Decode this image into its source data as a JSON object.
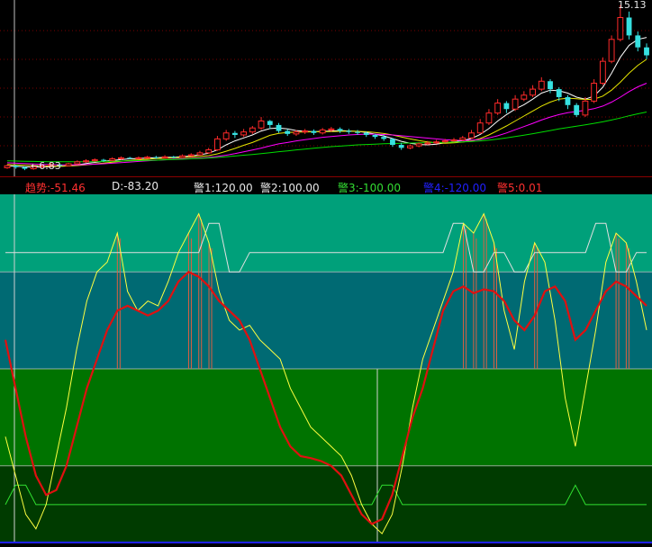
{
  "chart_data": [
    {
      "type": "candlestick",
      "annotations": [
        {
          "text": "←6.83",
          "kind": "low-price-label"
        },
        {
          "text": "15.13",
          "kind": "high-price-label"
        }
      ],
      "candles": [
        [
          6.95,
          7.05,
          7.12,
          6.9
        ],
        [
          7.05,
          6.98,
          7.1,
          6.9
        ],
        [
          6.98,
          6.9,
          7.02,
          6.83
        ],
        [
          6.9,
          7.0,
          7.05,
          6.85
        ],
        [
          7.0,
          7.05,
          7.1,
          6.95
        ],
        [
          7.05,
          7.1,
          7.18,
          7.0
        ],
        [
          7.1,
          7.05,
          7.15,
          7.0
        ],
        [
          7.05,
          7.15,
          7.2,
          7.02
        ],
        [
          7.15,
          7.25,
          7.32,
          7.1
        ],
        [
          7.25,
          7.3,
          7.38,
          7.2
        ],
        [
          7.3,
          7.35,
          7.42,
          7.25
        ],
        [
          7.35,
          7.32,
          7.4,
          7.25
        ],
        [
          7.32,
          7.4,
          7.48,
          7.28
        ],
        [
          7.4,
          7.45,
          7.52,
          7.35
        ],
        [
          7.45,
          7.42,
          7.5,
          7.38
        ],
        [
          7.42,
          7.45,
          7.52,
          7.36
        ],
        [
          7.45,
          7.48,
          7.55,
          7.4
        ],
        [
          7.48,
          7.45,
          7.55,
          7.4
        ],
        [
          7.45,
          7.5,
          7.58,
          7.42
        ],
        [
          7.5,
          7.48,
          7.55,
          7.42
        ],
        [
          7.48,
          7.55,
          7.62,
          7.45
        ],
        [
          7.55,
          7.6,
          7.68,
          7.5
        ],
        [
          7.6,
          7.7,
          7.8,
          7.55
        ],
        [
          7.7,
          7.85,
          7.95,
          7.65
        ],
        [
          7.85,
          8.4,
          8.55,
          7.8
        ],
        [
          8.4,
          8.7,
          8.85,
          8.3
        ],
        [
          8.7,
          8.6,
          8.8,
          8.45
        ],
        [
          8.6,
          8.75,
          8.9,
          8.5
        ],
        [
          8.75,
          8.95,
          9.05,
          8.65
        ],
        [
          8.95,
          9.3,
          9.5,
          8.85
        ],
        [
          9.3,
          9.1,
          9.35,
          8.9
        ],
        [
          9.1,
          8.8,
          9.2,
          8.7
        ],
        [
          8.8,
          8.65,
          8.9,
          8.55
        ],
        [
          8.65,
          8.75,
          8.85,
          8.55
        ],
        [
          8.75,
          8.8,
          8.9,
          8.65
        ],
        [
          8.8,
          8.7,
          8.88,
          8.6
        ],
        [
          8.7,
          8.85,
          8.95,
          8.62
        ],
        [
          8.85,
          8.9,
          9.0,
          8.75
        ],
        [
          8.9,
          8.8,
          8.98,
          8.7
        ],
        [
          8.8,
          8.75,
          8.9,
          8.65
        ],
        [
          8.75,
          8.7,
          8.85,
          8.6
        ],
        [
          8.7,
          8.6,
          8.78,
          8.5
        ],
        [
          8.6,
          8.5,
          8.65,
          8.4
        ],
        [
          8.5,
          8.4,
          8.6,
          8.3
        ],
        [
          8.4,
          8.1,
          8.45,
          8.0
        ],
        [
          8.1,
          7.95,
          8.2,
          7.85
        ],
        [
          7.95,
          8.05,
          8.12,
          7.88
        ],
        [
          8.05,
          8.15,
          8.22,
          7.98
        ],
        [
          8.15,
          8.2,
          8.3,
          8.1
        ],
        [
          8.2,
          8.25,
          8.35,
          8.15
        ],
        [
          8.25,
          8.3,
          8.4,
          8.2
        ],
        [
          8.3,
          8.35,
          8.45,
          8.25
        ],
        [
          8.35,
          8.45,
          8.55,
          8.3
        ],
        [
          8.45,
          8.7,
          8.85,
          8.4
        ],
        [
          8.7,
          9.2,
          9.4,
          8.65
        ],
        [
          9.2,
          9.7,
          9.9,
          9.1
        ],
        [
          9.7,
          10.2,
          10.4,
          9.6
        ],
        [
          10.2,
          9.9,
          10.3,
          9.7
        ],
        [
          9.9,
          10.4,
          10.6,
          9.8
        ],
        [
          10.4,
          10.6,
          10.8,
          10.3
        ],
        [
          10.6,
          10.9,
          11.1,
          10.5
        ],
        [
          10.9,
          11.3,
          11.5,
          10.8
        ],
        [
          11.3,
          10.9,
          11.4,
          10.7
        ],
        [
          10.9,
          10.5,
          11.0,
          10.3
        ],
        [
          10.5,
          10.1,
          10.6,
          9.9
        ],
        [
          10.1,
          9.6,
          10.2,
          9.5
        ],
        [
          9.6,
          10.3,
          10.5,
          9.5
        ],
        [
          10.3,
          11.2,
          11.4,
          10.2
        ],
        [
          11.2,
          12.3,
          12.5,
          11.1
        ],
        [
          12.3,
          13.4,
          13.6,
          12.2
        ],
        [
          13.4,
          14.5,
          15.13,
          13.3
        ],
        [
          14.5,
          13.6,
          14.8,
          13.4
        ],
        [
          13.6,
          13.0,
          13.8,
          12.8
        ],
        [
          13.0,
          12.6,
          13.2,
          12.4
        ]
      ],
      "moving_averages": [
        {
          "color": "#ffffff",
          "values": [
            7.05,
            7.03,
            7.0,
            6.98,
            6.98,
            7.0,
            7.02,
            7.05,
            7.1,
            7.16,
            7.22,
            7.28,
            7.32,
            7.36,
            7.4,
            7.42,
            7.44,
            7.46,
            7.47,
            7.48,
            7.5,
            7.54,
            7.6,
            7.68,
            7.85,
            8.1,
            8.3,
            8.45,
            8.6,
            8.8,
            8.92,
            8.95,
            8.9,
            8.82,
            8.78,
            8.76,
            8.78,
            8.8,
            8.82,
            8.8,
            8.78,
            8.72,
            8.64,
            8.55,
            8.42,
            8.28,
            8.18,
            8.12,
            8.1,
            8.14,
            8.2,
            8.26,
            8.32,
            8.42,
            8.62,
            8.92,
            9.3,
            9.62,
            9.9,
            10.12,
            10.4,
            10.7,
            10.85,
            10.82,
            10.7,
            10.5,
            10.4,
            10.55,
            11.0,
            11.7,
            12.5,
            13.1,
            13.4,
            13.5
          ]
        },
        {
          "color": "#e6e600",
          "values": [
            7.12,
            7.1,
            7.08,
            7.06,
            7.04,
            7.03,
            7.03,
            7.04,
            7.06,
            7.1,
            7.14,
            7.19,
            7.23,
            7.28,
            7.32,
            7.35,
            7.38,
            7.41,
            7.43,
            7.45,
            7.47,
            7.49,
            7.52,
            7.56,
            7.65,
            7.78,
            7.92,
            8.08,
            8.22,
            8.4,
            8.58,
            8.68,
            8.72,
            8.74,
            8.75,
            8.76,
            8.76,
            8.77,
            8.78,
            8.79,
            8.78,
            8.76,
            8.72,
            8.67,
            8.6,
            8.5,
            8.4,
            8.32,
            8.25,
            8.2,
            8.18,
            8.2,
            8.24,
            8.3,
            8.42,
            8.6,
            8.82,
            9.05,
            9.3,
            9.55,
            9.8,
            10.05,
            10.25,
            10.4,
            10.45,
            10.42,
            10.38,
            10.4,
            10.55,
            10.85,
            11.25,
            11.7,
            12.1,
            12.4
          ]
        },
        {
          "color": "#ff00ff",
          "values": [
            7.2,
            7.18,
            7.16,
            7.14,
            7.12,
            7.11,
            7.1,
            7.1,
            7.1,
            7.11,
            7.13,
            7.15,
            7.18,
            7.21,
            7.24,
            7.27,
            7.3,
            7.33,
            7.35,
            7.38,
            7.4,
            7.42,
            7.44,
            7.47,
            7.52,
            7.58,
            7.66,
            7.75,
            7.84,
            7.94,
            8.05,
            8.15,
            8.22,
            8.3,
            8.36,
            8.42,
            8.48,
            8.52,
            8.56,
            8.6,
            8.62,
            8.64,
            8.64,
            8.62,
            8.6,
            8.56,
            8.52,
            8.48,
            8.44,
            8.4,
            8.36,
            8.33,
            8.32,
            8.33,
            8.37,
            8.45,
            8.56,
            8.7,
            8.86,
            9.02,
            9.18,
            9.35,
            9.5,
            9.62,
            9.72,
            9.78,
            9.84,
            9.92,
            10.05,
            10.25,
            10.5,
            10.78,
            11.02,
            11.2
          ]
        },
        {
          "color": "#00dd00",
          "values": [
            7.3,
            7.29,
            7.28,
            7.27,
            7.26,
            7.25,
            7.25,
            7.25,
            7.25,
            7.25,
            7.26,
            7.27,
            7.28,
            7.29,
            7.3,
            7.31,
            7.32,
            7.33,
            7.35,
            7.36,
            7.38,
            7.4,
            7.42,
            7.44,
            7.47,
            7.5,
            7.54,
            7.58,
            7.62,
            7.66,
            7.71,
            7.76,
            7.8,
            7.85,
            7.89,
            7.93,
            7.97,
            8.01,
            8.04,
            8.07,
            8.1,
            8.12,
            8.14,
            8.16,
            8.17,
            8.18,
            8.19,
            8.2,
            8.21,
            8.22,
            8.23,
            8.24,
            8.25,
            8.27,
            8.3,
            8.34,
            8.39,
            8.45,
            8.52,
            8.59,
            8.66,
            8.74,
            8.82,
            8.9,
            8.97,
            9.04,
            9.11,
            9.18,
            9.26,
            9.35,
            9.45,
            9.56,
            9.66,
            9.75
          ]
        }
      ],
      "ylim": [
        6.7,
        15.2
      ]
    },
    {
      "type": "line",
      "legend": [
        {
          "text": "趋势:-51.46",
          "color": "#ff3030"
        },
        {
          "text": "D:-83.20",
          "color": "#e8e8e8"
        },
        {
          "text": "警1:120.00",
          "color": "#e8e8e8"
        },
        {
          "text": "警2:100.00",
          "color": "#e8e8e8"
        },
        {
          "text": "警3:-100.00",
          "color": "#33dd33"
        },
        {
          "text": "警4:-120.00",
          "color": "#2020ff"
        },
        {
          "text": "警5:0.01",
          "color": "#ff3030"
        }
      ],
      "ylim": [
        -180,
        180
      ],
      "levels": [
        100,
        0,
        -100
      ],
      "bands": [
        {
          "from": 100,
          "to": 180,
          "color": "#00a07a"
        },
        {
          "from": 0,
          "to": 100,
          "color": "#006a73"
        },
        {
          "from": -100,
          "to": 0,
          "color": "#007300"
        },
        {
          "from": -180,
          "to": -100,
          "color": "#003b00"
        }
      ],
      "series": [
        {
          "color": "#ffff40",
          "values": [
            -70,
            -110,
            -150,
            -165,
            -140,
            -90,
            -40,
            20,
            70,
            100,
            110,
            140,
            80,
            60,
            70,
            65,
            90,
            120,
            140,
            160,
            130,
            80,
            50,
            40,
            45,
            30,
            20,
            10,
            -20,
            -40,
            -60,
            -70,
            -80,
            -90,
            -110,
            -140,
            -160,
            -170,
            -150,
            -100,
            -40,
            10,
            40,
            70,
            100,
            150,
            140,
            160,
            130,
            60,
            20,
            90,
            130,
            110,
            50,
            -30,
            -80,
            -20,
            40,
            110,
            140,
            130,
            90,
            40
          ]
        },
        {
          "color": "#e01010",
          "values": [
            30,
            -20,
            -70,
            -110,
            -130,
            -125,
            -100,
            -60,
            -20,
            10,
            40,
            60,
            65,
            60,
            55,
            60,
            70,
            90,
            100,
            95,
            85,
            70,
            60,
            50,
            30,
            0,
            -30,
            -60,
            -80,
            -90,
            -92,
            -95,
            -100,
            -110,
            -130,
            -150,
            -160,
            -155,
            -130,
            -90,
            -50,
            -20,
            20,
            60,
            80,
            85,
            78,
            82,
            80,
            70,
            50,
            40,
            55,
            80,
            85,
            70,
            30,
            40,
            60,
            80,
            90,
            85,
            75,
            65
          ]
        }
      ],
      "signal_values": [
        -140,
        -120,
        -120,
        -140,
        -140,
        -140,
        -140,
        -140,
        -140,
        -140,
        -140,
        -140,
        -140,
        -140,
        -140,
        -140,
        -140,
        -140,
        -140,
        -140,
        -140,
        -140,
        -140,
        -140,
        -140,
        -140,
        -140,
        -140,
        -140,
        -140,
        -140,
        -140,
        -140,
        -140,
        -140,
        -140,
        -140,
        -120,
        -120,
        -140,
        -140,
        -140,
        -140,
        -140,
        -140,
        -140,
        -140,
        -140,
        -140,
        -140,
        -140,
        -140,
        -140,
        -140,
        -140,
        -140,
        -120,
        -140,
        -140,
        -140,
        -140,
        -140,
        -140,
        -140
      ],
      "upper_signal_values": [
        120,
        120,
        120,
        120,
        120,
        120,
        120,
        120,
        120,
        120,
        120,
        120,
        120,
        120,
        120,
        120,
        120,
        120,
        120,
        120,
        150,
        150,
        100,
        100,
        120,
        120,
        120,
        120,
        120,
        120,
        120,
        120,
        120,
        120,
        120,
        120,
        120,
        120,
        120,
        120,
        120,
        120,
        120,
        120,
        150,
        150,
        100,
        100,
        120,
        120,
        100,
        100,
        120,
        120,
        120,
        120,
        120,
        120,
        150,
        150,
        100,
        100,
        120,
        120
      ]
    }
  ]
}
